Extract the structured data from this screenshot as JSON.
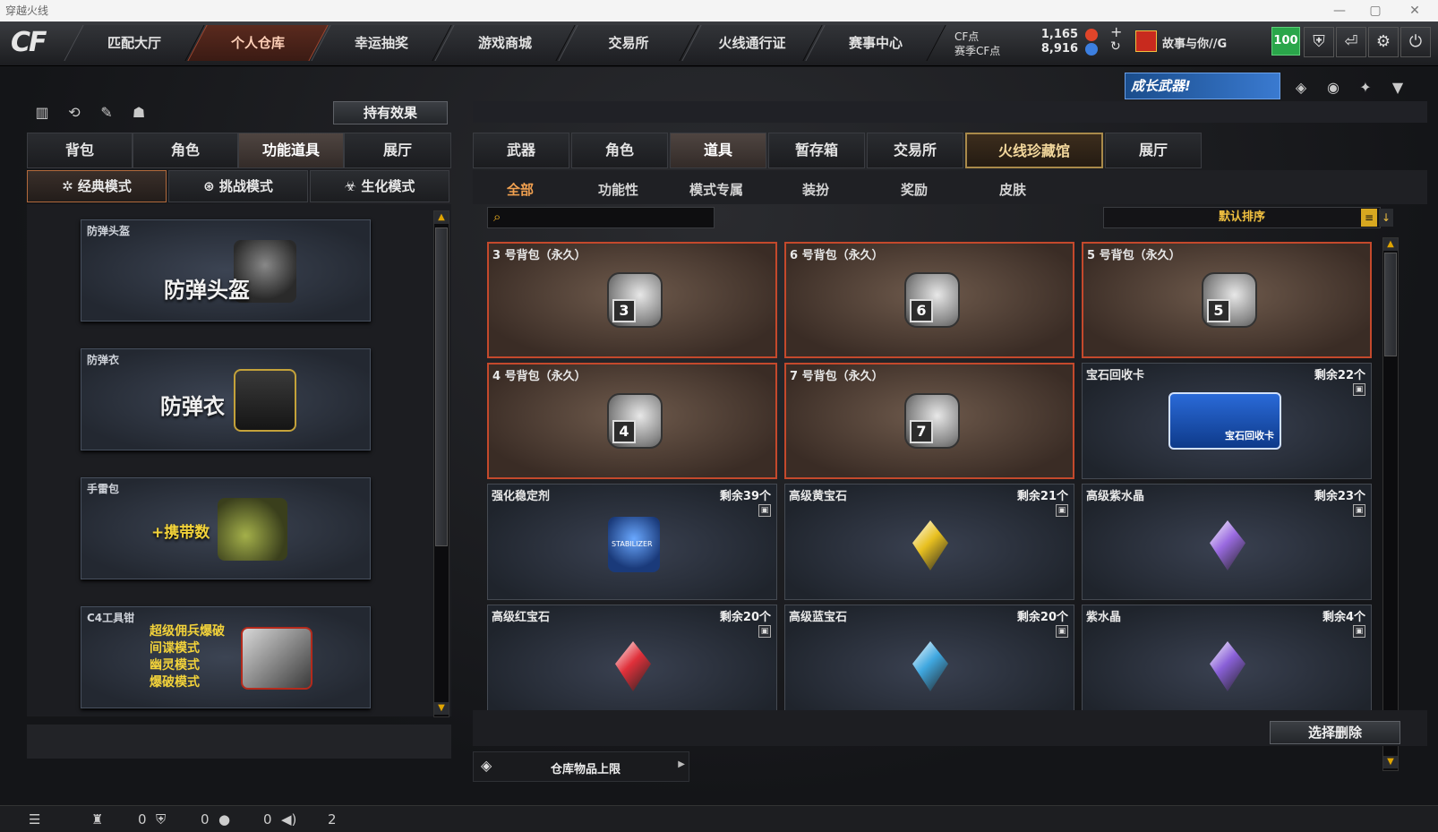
{
  "window": {
    "title": "穿越火线",
    "controls": [
      "—",
      "▢",
      "✕"
    ]
  },
  "nav": {
    "tabs": [
      "匹配大厅",
      "个人仓库",
      "幸运抽奖",
      "游戏商城",
      "交易所",
      "火线通行证",
      "赛事中心"
    ],
    "active": 1
  },
  "currency": {
    "cf_label": "CF点",
    "cf_value": "1,165",
    "season_label": "赛季CF点",
    "season_value": "8,916",
    "plus": "+",
    "refresh": "↻"
  },
  "user": {
    "name": "故事与你//G",
    "level": "100"
  },
  "banner": {
    "text": "成长武器!"
  },
  "left": {
    "hold_effect_btn": "持有效果",
    "tabs": [
      "背包",
      "角色",
      "功能道具",
      "展厅"
    ],
    "active_tab": 2,
    "modes": [
      {
        "label": "经典模式",
        "icon": "classic-mode-icon"
      },
      {
        "label": "挑战模式",
        "icon": "challenge-mode-icon"
      },
      {
        "label": "生化模式",
        "icon": "bio-mode-icon"
      }
    ],
    "cards": [
      {
        "label": "防弹头盔",
        "art": "防弹头盔"
      },
      {
        "label": "防弹衣",
        "art": "防弹衣"
      },
      {
        "label": "手雷包",
        "art": "+携带数"
      },
      {
        "label": "C4工具钳",
        "art_lines": [
          "超级佣兵爆破",
          "间谍模式",
          "幽灵模式",
          "爆破模式"
        ]
      }
    ]
  },
  "right": {
    "tabs": [
      "武器",
      "角色",
      "道具",
      "暂存箱",
      "交易所",
      "火线珍藏馆",
      "展厅"
    ],
    "active_tab": 2,
    "gold_tab": 5,
    "subtabs": [
      "全部",
      "功能性",
      "模式专属",
      "装扮",
      "奖励",
      "皮肤"
    ],
    "active_subtab": 0,
    "search": {
      "placeholder": ""
    },
    "sort": {
      "label": "默认排序"
    },
    "items": [
      {
        "name": "3 号背包（永久）",
        "type": "bag",
        "num": "3"
      },
      {
        "name": "6 号背包（永久）",
        "type": "bag",
        "num": "6"
      },
      {
        "name": "5 号背包（永久）",
        "type": "bag",
        "num": "5"
      },
      {
        "name": "4 号背包（永久）",
        "type": "bag",
        "num": "4"
      },
      {
        "name": "7 号背包（永久）",
        "type": "bag",
        "num": "7"
      },
      {
        "name": "宝石回收卡",
        "type": "card",
        "count": "剩余22个",
        "card_text": "宝石回收卡"
      },
      {
        "name": "强化稳定剂",
        "type": "stabilizer",
        "count": "剩余39个",
        "stab_text": "STABILIZER"
      },
      {
        "name": "高级黄宝石",
        "type": "gem",
        "count": "剩余21个",
        "color": "#e8c020"
      },
      {
        "name": "高级紫水晶",
        "type": "gem",
        "count": "剩余23个",
        "color": "#9a6ae0"
      },
      {
        "name": "高级红宝石",
        "type": "gem",
        "count": "剩余20个",
        "color": "#e0303a"
      },
      {
        "name": "高级蓝宝石",
        "type": "gem",
        "count": "剩余20个",
        "color": "#40a8e0"
      },
      {
        "name": "紫水晶",
        "type": "gem",
        "count": "剩余4个",
        "color": "#8a60d8"
      }
    ],
    "select_delete_btn": "选择删除",
    "storage_limit": "仓库物品上限"
  },
  "status": {
    "friends": "0",
    "guild": "0",
    "chat": "0",
    "volume": "2"
  }
}
